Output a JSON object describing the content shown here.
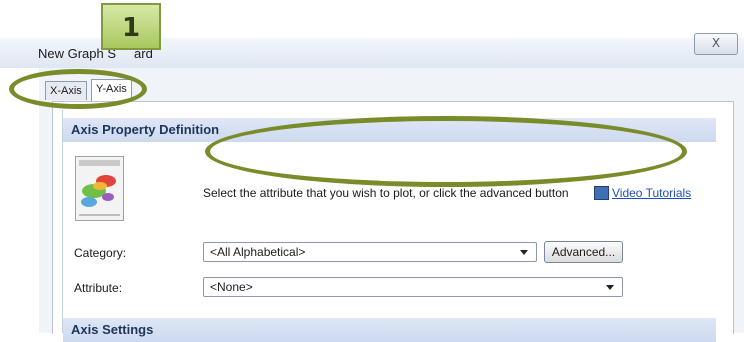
{
  "window": {
    "title": "New Graph S",
    "title_tail": "ard",
    "close_label": "X"
  },
  "callout": {
    "number": "1",
    "color": "#a9c85f"
  },
  "tabs": [
    {
      "label": "X-Axis"
    },
    {
      "label": "Y-Axis"
    }
  ],
  "sections": {
    "axis_property": "Axis Property Definition",
    "axis_settings": "Axis Settings"
  },
  "help_text": "Select the attribute that you wish to plot, or click the advanced button",
  "video_link": {
    "label": "Video Tutorials",
    "icon": "film-icon"
  },
  "category": {
    "label": "Category:",
    "value": "<All Alphabetical>"
  },
  "attribute": {
    "label": "Attribute:",
    "value": "<None>"
  },
  "advanced_button": "Advanced...",
  "colors": {
    "accent": "#7a8c2a",
    "header_text": "#1d3558",
    "link": "#1f4fc2"
  }
}
